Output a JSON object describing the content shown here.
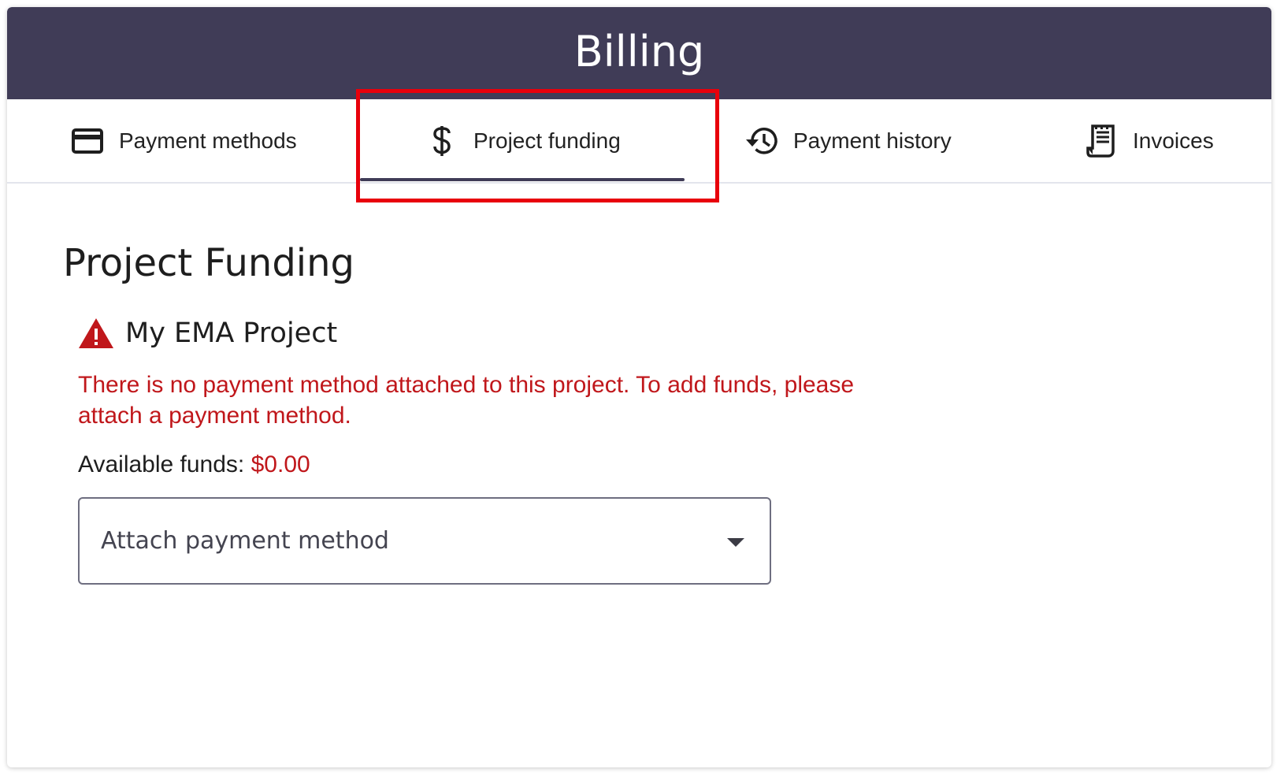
{
  "header": {
    "title": "Billing"
  },
  "tabs": [
    {
      "id": "payment-methods",
      "label": "Payment methods",
      "icon": "credit-card-icon",
      "selected": false
    },
    {
      "id": "project-funding",
      "label": "Project funding",
      "icon": "dollar-icon",
      "selected": true
    },
    {
      "id": "payment-history",
      "label": "Payment history",
      "icon": "history-icon",
      "selected": false
    },
    {
      "id": "invoices",
      "label": "Invoices",
      "icon": "receipt-icon",
      "selected": false
    }
  ],
  "main": {
    "page_title": "Project Funding",
    "project": {
      "name": "My EMA Project",
      "status_icon": "warning-icon",
      "error_message": "There is no payment method attached to this project. To add funds, please attach a payment method.",
      "funds_label": "Available funds:",
      "funds_value": "$0.00"
    },
    "attach_select": {
      "placeholder": "Attach payment method"
    }
  },
  "colors": {
    "header_bg": "#403c57",
    "error_red": "#c0171b",
    "highlight_red": "#e8000b",
    "text_dark": "#1e1e1e"
  }
}
